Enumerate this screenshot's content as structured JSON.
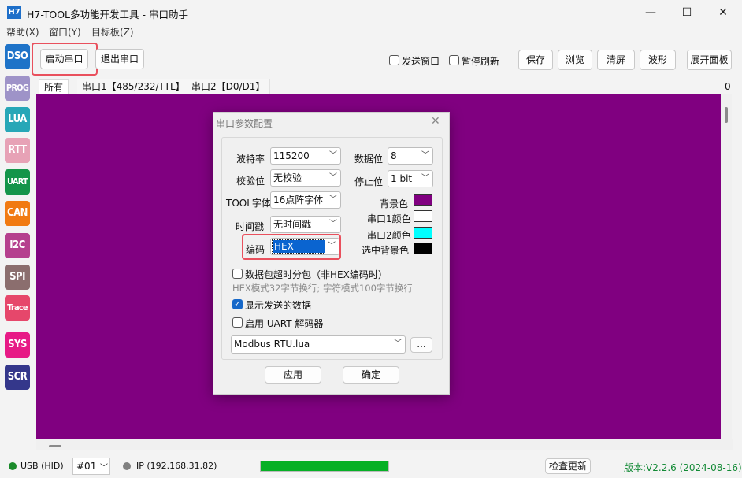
{
  "window": {
    "title": "H7-TOOL多功能开发工具 - 串口助手",
    "icon_text": "H7",
    "minimize": "—",
    "maximize": "☐",
    "close": "✕"
  },
  "menu": [
    "帮助(X)",
    "窗口(Y)",
    "目标板(Z)"
  ],
  "sidebar": [
    {
      "label": "DSO",
      "color": "#1e73c8"
    },
    {
      "label": "PROG",
      "color": "#9e93c8"
    },
    {
      "label": "LUA",
      "color": "#27a7b7"
    },
    {
      "label": "RTT",
      "color": "#e7a2b6"
    },
    {
      "label": "UART",
      "color": "#14954a"
    },
    {
      "label": "CAN",
      "color": "#f17a12"
    },
    {
      "label": "I2C",
      "color": "#b5408e"
    },
    {
      "label": "SPI",
      "color": "#8b6e6e"
    },
    {
      "label": "Trace",
      "color": "#e6476b"
    },
    {
      "label": "SYS",
      "color": "#e71a86"
    },
    {
      "label": "SCR",
      "color": "#34378b"
    }
  ],
  "toolbar": {
    "start_port": "启动串口",
    "exit_port": "退出串口",
    "send_window": "发送窗口",
    "pause_refresh": "暂停刷新",
    "save": "保存",
    "browse": "浏览",
    "clear": "清屏",
    "wave": "波形",
    "expand_panel": "展开面板"
  },
  "tabs": [
    "所有",
    "串口1【485/232/TTL】",
    "串口2【D0/D1】"
  ],
  "counter": "0",
  "dialog": {
    "title": "串口参数配置",
    "close": "✕",
    "baud_label": "波特率",
    "baud_value": "115200",
    "databits_label": "数据位",
    "databits_value": "8",
    "parity_label": "校验位",
    "parity_value": "无校验",
    "stopbits_label": "停止位",
    "stopbits_value": "1 bit",
    "font_label": "TOOL字体",
    "font_value": "16点阵字体",
    "timestamp_label": "时间戳",
    "timestamp_value": "无时间戳",
    "encoding_label": "编码",
    "encoding_value": "HEX",
    "bg_label": "背景色",
    "bg_color": "#800080",
    "port1_label": "串口1颜色",
    "port1_color": "#ffffff",
    "port2_label": "串口2颜色",
    "port2_color": "#00ffff",
    "selbg_label": "选中背景色",
    "selbg_color": "#000000",
    "packet_timeout": "数据包超时分包（非HEX编码时）",
    "hint": "HEX模式32字节换行; 字符模式100字节换行",
    "show_sent": "显示发送的数据",
    "show_sent_checked": true,
    "uart_decoder": "启用 UART 解码器",
    "decoder_value": "Modbus RTU.lua",
    "browse_btn": "...",
    "apply": "应用",
    "ok": "确定"
  },
  "status": {
    "usb": "USB (HID)",
    "device": "#01",
    "ip": "IP (192.168.31.82)",
    "progress": 1.0,
    "check_update": "检查更新",
    "version": "版本:V2.2.6 (2024-08-16)"
  }
}
